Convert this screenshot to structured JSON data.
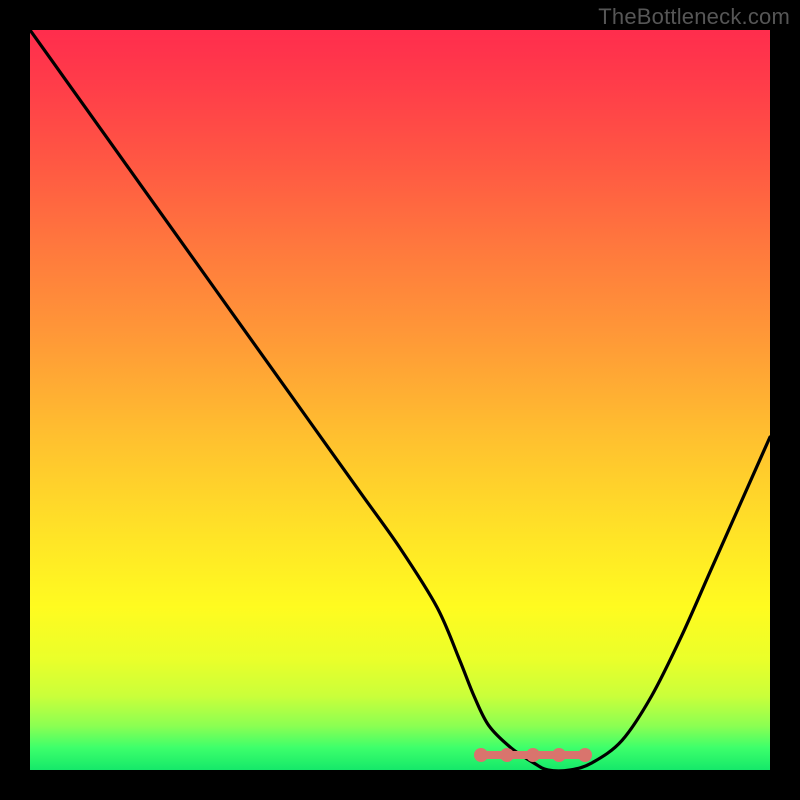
{
  "watermark": "TheBottleneck.com",
  "colors": {
    "frame_bg": "#000000",
    "grad_top": "#ff2d4d",
    "grad_bottom": "#15e86a",
    "curve": "#000000",
    "bump": "#d9746d"
  },
  "chart_data": {
    "type": "line",
    "title": "",
    "xlabel": "",
    "ylabel": "",
    "xlim": [
      0,
      100
    ],
    "ylim": [
      0,
      100
    ],
    "x": [
      0,
      5,
      10,
      15,
      20,
      25,
      30,
      35,
      40,
      45,
      50,
      55,
      58,
      60,
      62,
      65,
      68,
      70,
      73,
      76,
      80,
      84,
      88,
      92,
      96,
      100
    ],
    "values": [
      100,
      93,
      86,
      79,
      72,
      65,
      58,
      51,
      44,
      37,
      30,
      22,
      15,
      10,
      6,
      3,
      1,
      0,
      0,
      1,
      4,
      10,
      18,
      27,
      36,
      45
    ],
    "series": [
      {
        "name": "bottleneck-curve",
        "x": [
          0,
          5,
          10,
          15,
          20,
          25,
          30,
          35,
          40,
          45,
          50,
          55,
          58,
          60,
          62,
          65,
          68,
          70,
          73,
          76,
          80,
          84,
          88,
          92,
          96,
          100
        ],
        "values": [
          100,
          93,
          86,
          79,
          72,
          65,
          58,
          51,
          44,
          37,
          30,
          22,
          15,
          10,
          6,
          3,
          1,
          0,
          0,
          1,
          4,
          10,
          18,
          27,
          36,
          45
        ]
      }
    ],
    "optimal_range_x": [
      60,
      76
    ],
    "background_gradient": {
      "top": "#ff2d4d",
      "bottom": "#15e86a"
    }
  }
}
